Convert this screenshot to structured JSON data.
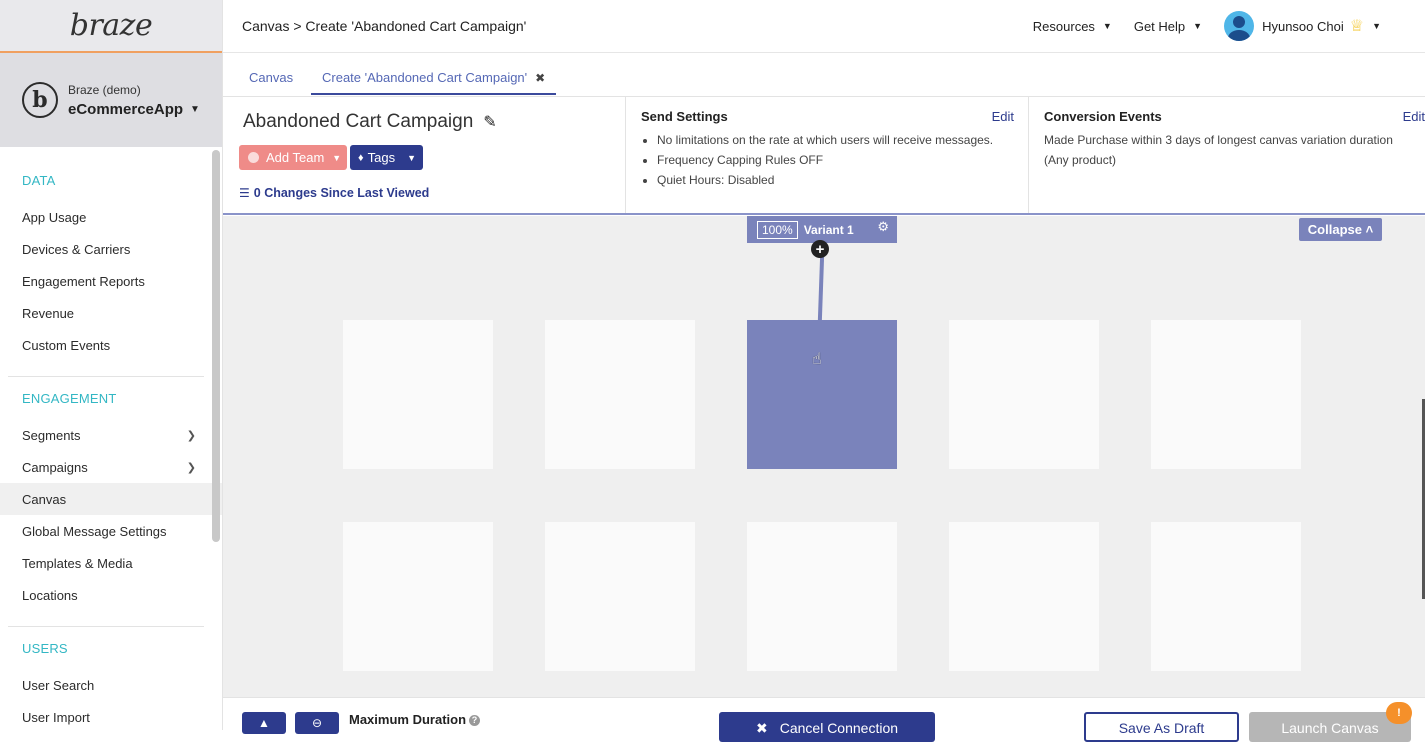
{
  "brand": {
    "logo_text": "braze",
    "accent": "#2d3b8d",
    "teal": "#33b7c4"
  },
  "app": {
    "company": "Braze (demo)",
    "name": "eCommerceApp"
  },
  "sidebar": {
    "sections": [
      {
        "title": "DATA",
        "items": [
          "App Usage",
          "Devices & Carriers",
          "Engagement Reports",
          "Revenue",
          "Custom Events"
        ]
      },
      {
        "title": "ENGAGEMENT",
        "items": [
          "Segments",
          "Campaigns",
          "Canvas",
          "Global Message Settings",
          "Templates & Media",
          "Locations"
        ]
      },
      {
        "title": "USERS",
        "items": [
          "User Search",
          "User Import"
        ]
      }
    ]
  },
  "topbar": {
    "breadcrumb": "Canvas > Create 'Abandoned Cart Campaign'",
    "resources": "Resources",
    "help": "Get Help",
    "user_name": "Hyunsoo Choi"
  },
  "tabs": [
    {
      "label": "Canvas"
    },
    {
      "label": "Create 'Abandoned Cart Campaign'"
    }
  ],
  "campaign": {
    "title": "Abandoned Cart Campaign",
    "add_team": "Add Team",
    "tags": "Tags",
    "changes": "0 Changes Since Last Viewed"
  },
  "send_settings": {
    "title": "Send Settings",
    "edit": "Edit",
    "items": [
      "No limitations on the rate at which users will receive messages.",
      "Frequency Capping Rules OFF",
      "Quiet Hours: Disabled"
    ]
  },
  "conversion_events": {
    "title": "Conversion Events",
    "edit": "Edit",
    "text": "Made Purchase within 3 days of longest canvas variation duration (Any product)"
  },
  "canvas": {
    "variant_percent": "100%",
    "variant_name": "Variant 1",
    "collapse": "Collapse"
  },
  "footer": {
    "max_duration": "Maximum Duration",
    "cancel_connection": "Cancel Connection",
    "save_draft": "Save As Draft",
    "launch": "Launch Canvas",
    "warning_badge": "!"
  }
}
